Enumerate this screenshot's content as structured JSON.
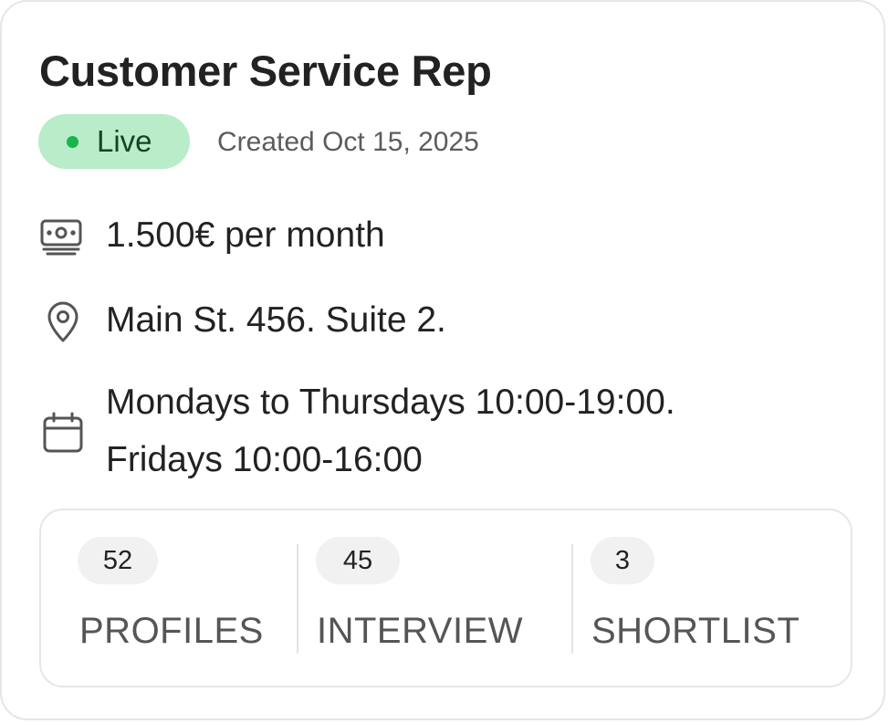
{
  "job": {
    "title": "Customer Service Rep",
    "status": "Live",
    "created": "Created Oct 15, 2025",
    "salary": "1.500€ per month",
    "address": "Main St. 456. Suite 2.",
    "schedule_line1": "Mondays to Thursdays 10:00-19:00.",
    "schedule_line2": "Fridays 10:00-16:00"
  },
  "icons": {
    "salary": "money-icon",
    "address": "location-pin-icon",
    "schedule": "calendar-icon"
  },
  "stats": [
    {
      "count": "52",
      "label": "PROFILES"
    },
    {
      "count": "45",
      "label": "INTERVIEW"
    },
    {
      "count": "3",
      "label": "SHORTLIST"
    }
  ],
  "colors": {
    "live_badge_bg": "#b9ecc8",
    "live_dot": "#19b54a",
    "border": "#e6e6e6"
  }
}
